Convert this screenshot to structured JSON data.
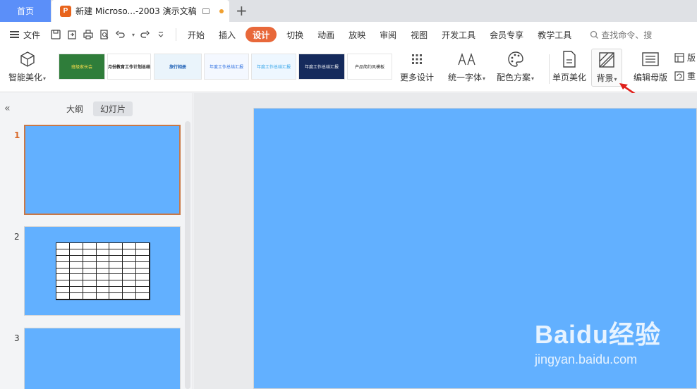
{
  "tabbar": {
    "home": "首页",
    "doc_title": "新建 Microso...-2003 演示文稿",
    "new_tab": "+"
  },
  "menu": {
    "file": "文件",
    "tabs": [
      "开始",
      "插入",
      "设计",
      "切换",
      "动画",
      "放映",
      "审阅",
      "视图",
      "开发工具",
      "会员专享",
      "教学工具"
    ],
    "active_tab": "设计",
    "search": "查找命令、搜"
  },
  "ribbon": {
    "smart_beautify": "智能美化",
    "more_design": "更多设计",
    "unify_font": "统一字体",
    "color_scheme": "配色方案",
    "single_page": "单页美化",
    "background": "背景",
    "edit_master": "编辑母版",
    "layout_partial": "版",
    "reset_partial": "重",
    "templates": [
      "班级家长会",
      "月份教育工作计划总结",
      "旅行相册",
      "年度工作总结汇报",
      "年度工作总结汇报",
      "年度工作总结汇报",
      "产品简约风模板"
    ]
  },
  "left_pane": {
    "outline": "大纲",
    "slides": "幻灯片",
    "slide_numbers": [
      "1",
      "2",
      "3"
    ]
  },
  "watermark": {
    "brand": "Baidu经验",
    "url": "jingyan.baidu.com"
  },
  "colors": {
    "slide_bg": "#62b0ff",
    "accent": "#e8683a",
    "home_tab": "#5b8ff9"
  }
}
